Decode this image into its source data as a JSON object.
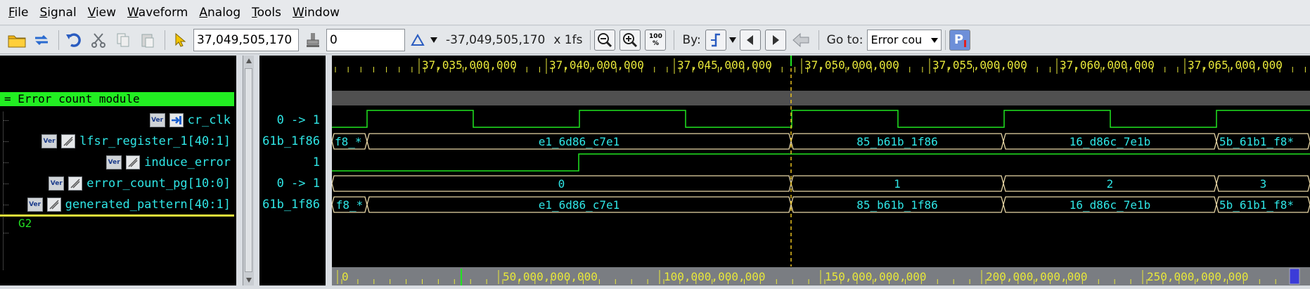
{
  "menu": [
    "File",
    "Signal",
    "View",
    "Waveform",
    "Analog",
    "Tools",
    "Window"
  ],
  "menu_underline": [
    "F",
    "S",
    "V",
    "W",
    "A",
    "T",
    "W"
  ],
  "toolbar": {
    "cursor_time": "37,049,505,170",
    "marker_time": "0",
    "delta_time": "-37,049,505,170",
    "timescale": "x 1fs",
    "by_label": "By:",
    "goto_label": "Go to:",
    "goto_value": "Error cou",
    "zoom_100_label": "100 %"
  },
  "group": {
    "name": "= Error count module"
  },
  "signals": [
    {
      "name": "cr_clk",
      "value": "0 -> 1",
      "type": "input"
    },
    {
      "name": "lfsr_register_1[40:1]",
      "value": "61b_1f86",
      "type": "bus"
    },
    {
      "name": "induce_error",
      "value": "1",
      "type": "bus"
    },
    {
      "name": "error_count_pg[10:0]",
      "value": "0 -> 1",
      "type": "bus"
    },
    {
      "name": "generated_pattern[40:1]",
      "value": "61b_1f86",
      "type": "bus"
    }
  ],
  "group2": {
    "name": "G2"
  },
  "ruler_top": [
    "37,035,000,000",
    "37,040,000,000",
    "37,045,000,000",
    "37,050,000,000",
    "37,055,000,000",
    "37,060,000,000",
    "37,065,000,000"
  ],
  "ruler_bottom": [
    "0",
    "50,000,000,000",
    "100,000,000,000",
    "150,000,000,000",
    "200,000,000,000",
    "250,000,000,000"
  ],
  "waves": {
    "lfsr": [
      "f8_*",
      "e1_6d86_c7e1",
      "85_b61b_1f86",
      "16_d86c_7e1b",
      "5b_61b1_f8*"
    ],
    "error_count": [
      "0",
      "1",
      "2",
      "3"
    ],
    "pattern": [
      "f8_*",
      "e1_6d86_c7e1",
      "85_b61b_1f86",
      "16_d86c_7e1b",
      "5b_61b1_f8*"
    ]
  },
  "colors": {
    "wave": "#21e521",
    "bus": "#e9d8a6",
    "text": "#2fe6e6",
    "ruler": "#e8e83a",
    "cursor": "#e8c020",
    "group": "#22ee22"
  }
}
